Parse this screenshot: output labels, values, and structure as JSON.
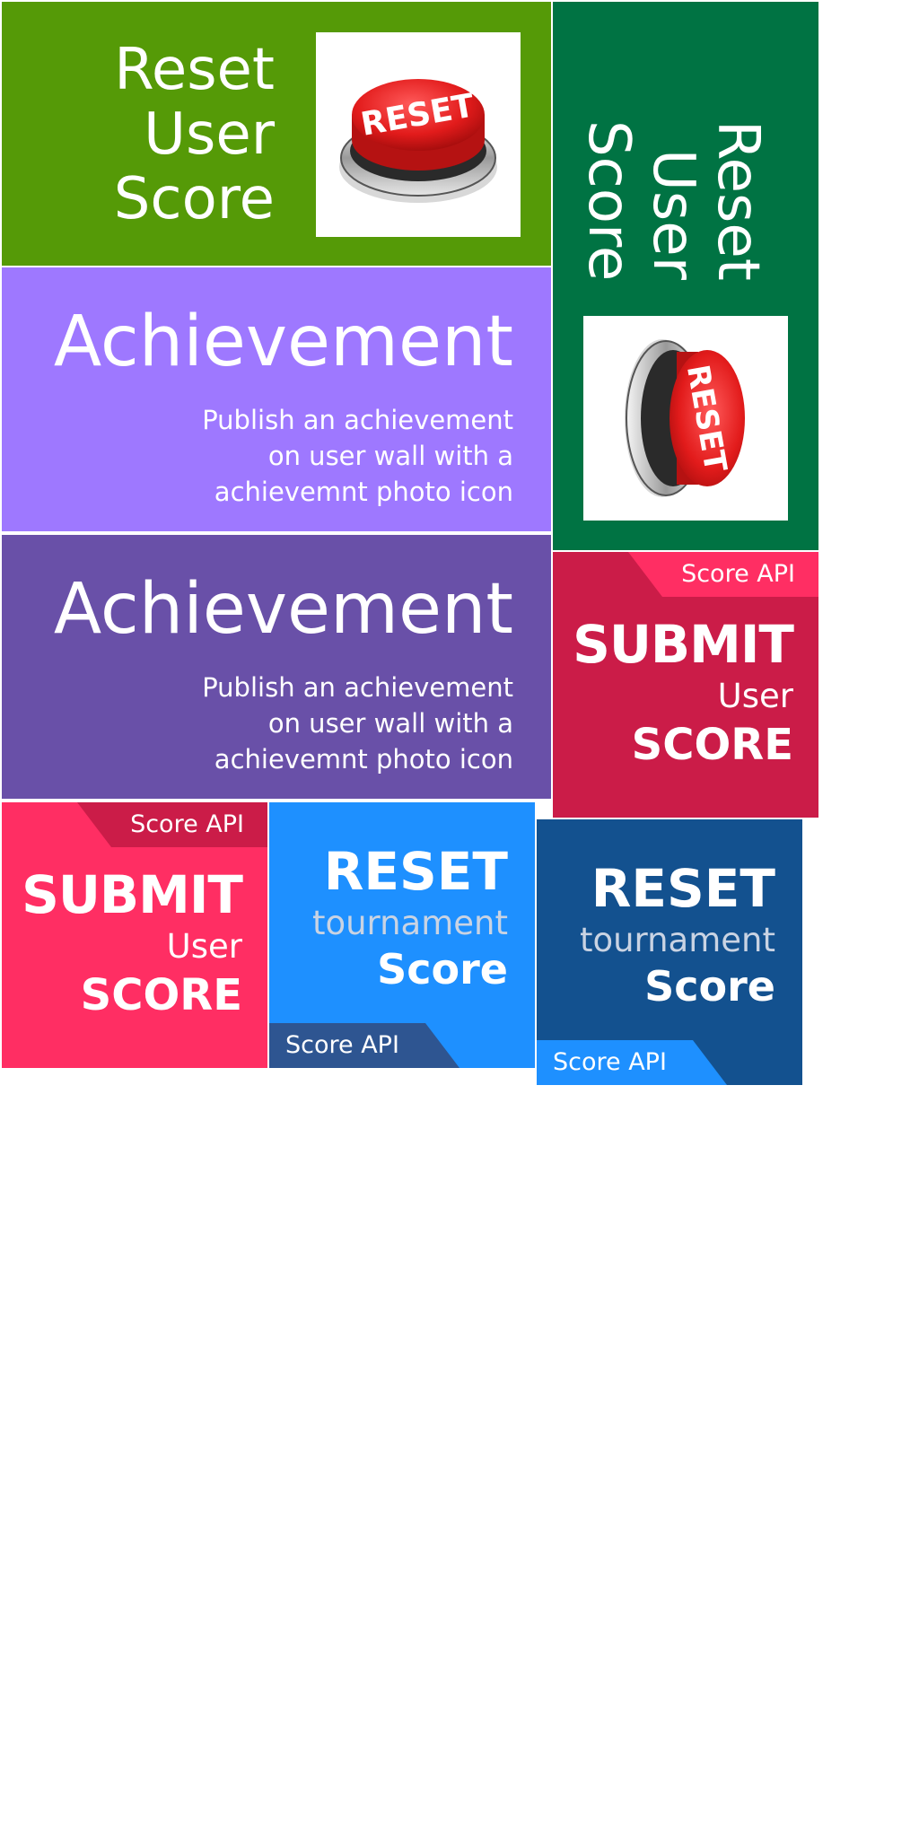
{
  "colors": {
    "reset_horizontal_bg": "#559A07",
    "reset_vertical_bg": "#007343",
    "achievement_light_bg": "#9E78FF",
    "achievement_dark_bg": "#6950A8",
    "submit_crimson_bg": "#CB1C48",
    "submit_crimson_ribbon": "#FF2E63",
    "submit_pink_bg": "#FF2E63",
    "submit_pink_ribbon": "#CB1C48",
    "tournament_light_bg": "#1E90FF",
    "tournament_light_ribbon": "#2E5591",
    "tournament_light_mid_text": "#C9D3E3",
    "tournament_dark_bg": "#13518F",
    "tournament_dark_ribbon": "#1E90FF",
    "tournament_dark_mid_text": "#C9D3E3",
    "reset_button_red": "#E21B1B"
  },
  "tiles": {
    "reset_user_score_h": {
      "lines": [
        "Reset",
        "User",
        "Score"
      ],
      "button_label": "RESET",
      "icon": "red-reset-button-icon"
    },
    "reset_user_score_v": {
      "lines": [
        "Reset",
        "User",
        "Score"
      ],
      "button_label": "RESET",
      "icon": "red-reset-button-icon"
    },
    "achievement_light": {
      "title": "Achievement",
      "lines": [
        "Publish an achievement",
        "on user wall with a",
        "achievemnt photo icon"
      ]
    },
    "achievement_dark": {
      "title": "Achievement",
      "lines": [
        "Publish an achievement",
        "on user wall with a",
        "achievemnt photo icon"
      ]
    },
    "submit_score_crimson": {
      "ribbon": "Score API",
      "line1": "SUBMIT",
      "line2": "User",
      "line3": "SCORE"
    },
    "submit_score_pink": {
      "ribbon": "Score API",
      "line1": "SUBMIT",
      "line2": "User",
      "line3": "SCORE"
    },
    "reset_tournament_light": {
      "line1": "RESET",
      "line2": "tournament",
      "line3": "Score",
      "ribbon": "Score API"
    },
    "reset_tournament_dark": {
      "line1": "RESET",
      "line2": "tournament",
      "line3": "Score",
      "ribbon": "Score API"
    }
  }
}
